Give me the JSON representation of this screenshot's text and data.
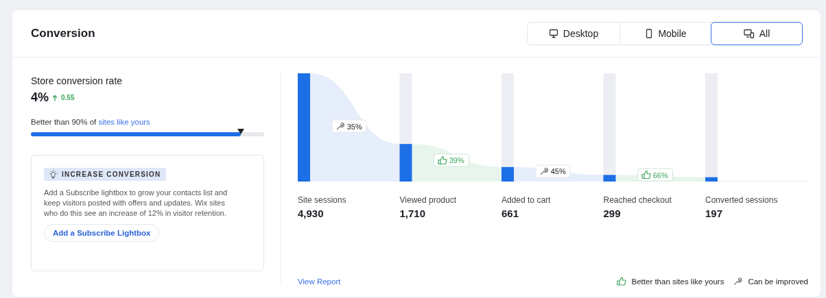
{
  "title": "Conversion",
  "device_tabs": [
    {
      "label": "Desktop",
      "kind": "desktop",
      "selected": false
    },
    {
      "label": "Mobile",
      "kind": "mobile",
      "selected": false
    },
    {
      "label": "All",
      "kind": "all",
      "selected": true
    }
  ],
  "rate": {
    "label": "Store conversion rate",
    "value": "4%",
    "change": "0.55",
    "comparison": "Better than 90% of ",
    "comparison_link": "sites like yours",
    "level": 0.9
  },
  "tip": {
    "tag": "INCREASE CONVERSION",
    "text": "Add a Subscribe lightbox to grow your contacts list and keep visitors posted with offers and updates. Wix sites who do this see an increase of 12% in visitor retention.",
    "button": "Add a Subscribe Lightbox"
  },
  "stages": [
    {
      "label": "Site sessions",
      "value": "4,930",
      "level": 1
    },
    {
      "label": "Viewed product",
      "value": "1,710",
      "level": 0.347
    },
    {
      "label": "Added to cart",
      "value": "661",
      "level": 0.134
    },
    {
      "label": "Reached checkout",
      "value": "299",
      "level": 0.061
    },
    {
      "label": "Converted sessions",
      "value": "197",
      "level": 0.04
    }
  ],
  "steps": [
    {
      "kind": "improve",
      "rate": "35%"
    },
    {
      "kind": "better",
      "rate": "39%"
    },
    {
      "kind": "improve",
      "rate": "45%"
    },
    {
      "kind": "better",
      "rate": "66%"
    }
  ],
  "view_report": "View Report",
  "legend": [
    {
      "kind": "better",
      "label": "Better than sites like yours"
    },
    {
      "kind": "improve",
      "label": "Can be improved"
    }
  ]
}
